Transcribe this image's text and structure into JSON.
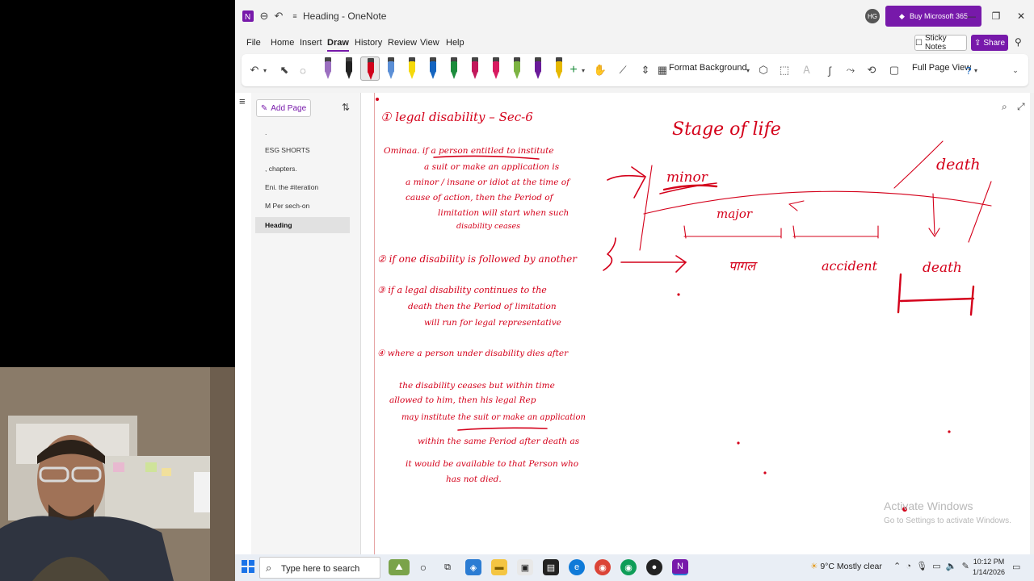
{
  "window": {
    "title": "Heading - OneNote",
    "avatar_initials": "HG",
    "buy_label": "Buy Microsoft 365",
    "accent": "#7719aa"
  },
  "menu": {
    "items": [
      "File",
      "Home",
      "Insert",
      "Draw",
      "History",
      "Review",
      "View",
      "Help"
    ],
    "active": "Draw",
    "sticky_notes": "Sticky Notes",
    "share": "Share"
  },
  "ribbon": {
    "format_background": "Format Background",
    "full_page_view": "Full Page View",
    "pen_colors": [
      "#9b6fc0",
      "#222222",
      "#d0021b",
      "#5b8fd6",
      "#f5d90a",
      "#1565c0",
      "#1c8c3c",
      "#c2185b",
      "#d81b60",
      "#7cb342",
      "#6a1b9a",
      "#e6b800"
    ]
  },
  "pagelist": {
    "add_page": "Add Page",
    "pages": [
      ".",
      "ESG SHORTS",
      ", chapters.",
      "Eni. the #iteration",
      "M Per sech-on",
      "Heading"
    ],
    "active_page": "Heading"
  },
  "note": {
    "ink_color": "#d4001a",
    "ink_text": {
      "h1": "① legal disability – Sec-6",
      "p1a": "Ominaa. if a person entitled to institute",
      "p1b": "a suit or make an application is",
      "p1c": "a minor / insane or idiot at the time of",
      "p1d": "cause of action, then the Period of",
      "p1e": "limitation will start when such",
      "p1f": "disability ceases",
      "p2": "② if one disability is followed by another",
      "p3a": "③ if a legal disability continues to the",
      "p3b": "death then the Period of limitation",
      "p3c": "will run for legal representative",
      "p4a": "④ where a person under disability dies after",
      "p4b": "the disability ceases but within time",
      "p4c": "allowed to him, then his legal Rep",
      "p4d": "may institute the suit or make an application",
      "p4e": "within the same Period after death as",
      "p4f": "it would be available to that Person who",
      "p4g": "has not died.",
      "stage": "Stage of life",
      "minor": "minor",
      "major": "major",
      "death_top": "death",
      "pagal": "पागल",
      "accident": "accident",
      "death_bottom": "death"
    },
    "watermark_title": "Activate Windows",
    "watermark_sub": "Go to Settings to activate Windows."
  },
  "taskbar": {
    "search_placeholder": "Type here to search",
    "weather": "9°C  Mostly clear",
    "time": "10:12 PM",
    "date": "1/14/2026"
  }
}
